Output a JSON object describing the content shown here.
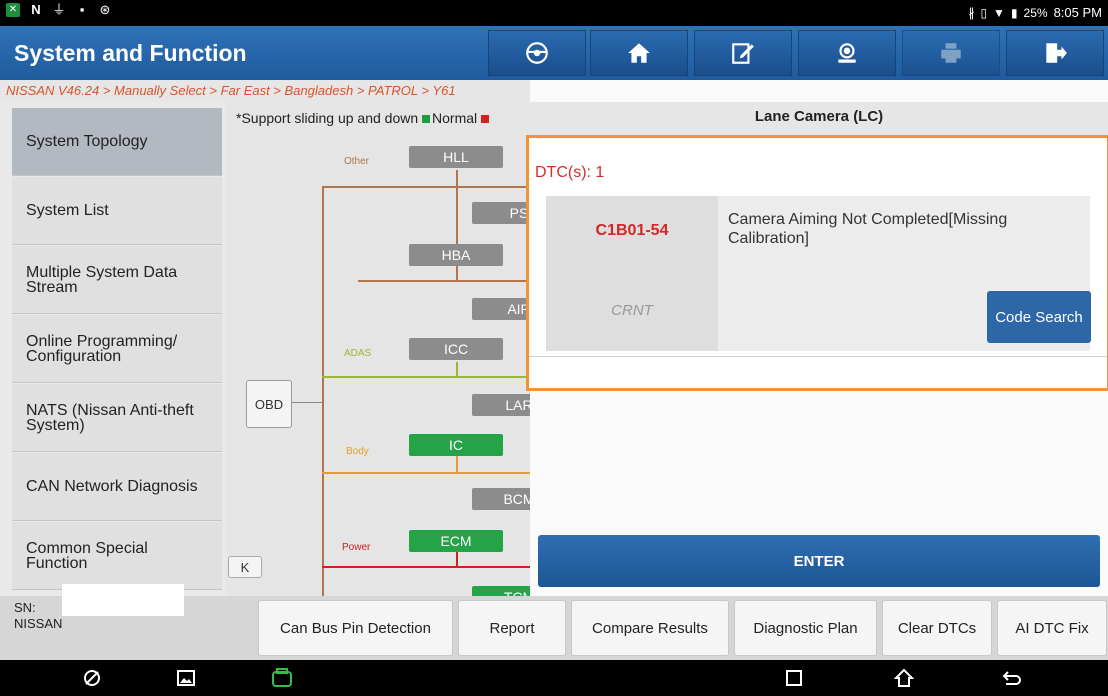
{
  "status_bar": {
    "left_icons": [
      "notification-app-icon",
      "n-icon",
      "usb-icon",
      "image-icon",
      "accessibility-icon"
    ],
    "battery": "25%",
    "time": "8:05 PM"
  },
  "header": {
    "title": "System and Function",
    "buttons": [
      "steering-wheel-icon",
      "home-icon",
      "edit-icon",
      "support-icon",
      "print-icon",
      "exit-icon"
    ]
  },
  "breadcrumb": "NISSAN V46.24 > Manually Select > Far East > Bangladesh > PATROL > Y61",
  "sidebar": {
    "items": [
      {
        "label": "System Topology"
      },
      {
        "label": "System List"
      },
      {
        "label": "Multiple System Data Stream"
      },
      {
        "label": "Online Programming/ Configuration"
      },
      {
        "label": "NATS (Nissan Anti-theft System)"
      },
      {
        "label": "CAN Network Diagnosis"
      },
      {
        "label": "Common Special Function"
      }
    ]
  },
  "topology": {
    "hint": "*Support sliding up and down",
    "legend_normal": "Normal",
    "obd": "OBD",
    "categories": {
      "other": "Other",
      "adas": "ADAS",
      "body": "Body",
      "power": "Power"
    },
    "nodes": {
      "hll": "HLL",
      "ps": "PS",
      "hba": "HBA",
      "air": "AIR",
      "icc": "ICC",
      "lar": "LAR",
      "ic": "IC",
      "bcm": "BCM",
      "ecm": "ECM",
      "tcm": "TCM"
    },
    "collapse": "K"
  },
  "panel": {
    "title": "Lane Camera (LC)",
    "dtc_count": "DTC(s): 1",
    "dtc": {
      "code": "C1B01-54",
      "status": "CRNT",
      "description": "Camera Aiming Not Completed[Missing Calibration]"
    },
    "code_search": "Code Search",
    "enter": "ENTER"
  },
  "footer": {
    "sn_label": "SN:",
    "brand": "NISSAN",
    "buttons": {
      "can_bus": "Can Bus Pin Detection",
      "report": "Report",
      "compare": "Compare Results",
      "plan": "Diagnostic Plan",
      "clear": "Clear DTCs",
      "ai_fix": "AI DTC Fix"
    }
  },
  "colors": {
    "header_blue": "#1f5b9e",
    "breadcrumb_orange": "#d9532c",
    "dtc_red": "#d42626",
    "highlight_orange": "#f29237",
    "node_green": "#24a348",
    "node_gray": "#8c8c8c"
  }
}
